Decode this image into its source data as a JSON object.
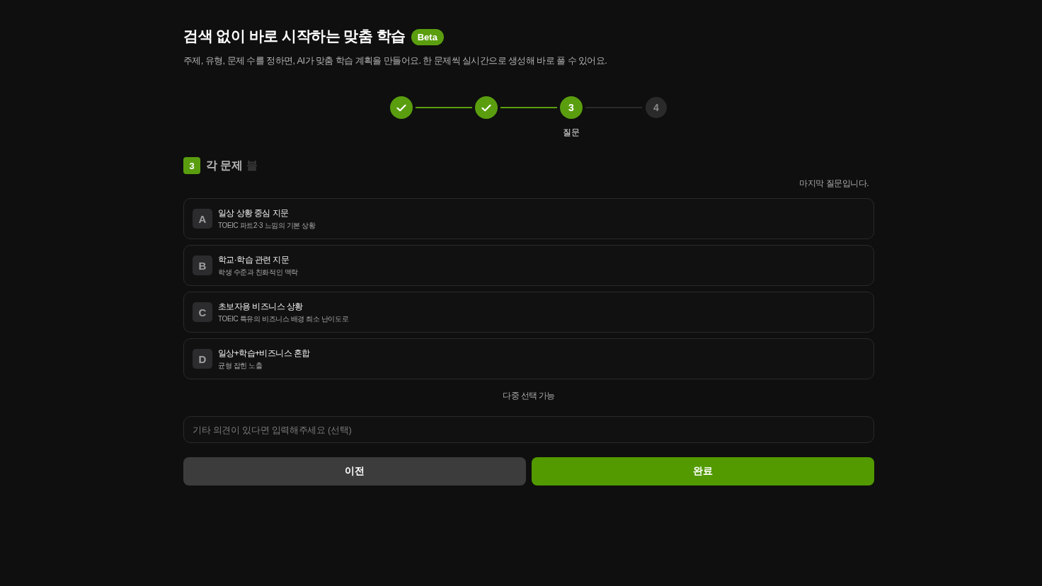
{
  "header": {
    "title": "검색 없이 바로 시작하는 맞춤 학습",
    "badge": "Beta",
    "subtitle": "주제, 유형, 문제 수를 정하면, AI가 맞춤 학습 계획을 만들어요. 한 문제씩 실시간으로 생성해 바로 풀 수 있어요."
  },
  "stepper": {
    "steps": [
      {
        "done": true,
        "current": false
      },
      {
        "done": true,
        "current": false
      },
      {
        "done": false,
        "current": true,
        "number": "3",
        "label": "질문"
      },
      {
        "done": false,
        "current": false,
        "number": "4"
      }
    ]
  },
  "question": {
    "number": "3",
    "title_parts": [
      {
        "text": "각 문제",
        "faded": false
      },
      {
        "text": "블",
        "faded": true
      }
    ],
    "note": "마지막 질문입니다.",
    "options": [
      {
        "letter": "A",
        "title": "일상 상황 중심 지문",
        "description": "TOEIC 파트2·3 느낌의 기본 상황",
        "selected": false
      },
      {
        "letter": "B",
        "title": "학교·학습 관련 지문",
        "description": "학생 수준과 친화적인 맥락",
        "selected": false
      },
      {
        "letter": "C",
        "title": "초보자용 비즈니스 상황",
        "description": "TOEIC 특유의 비즈니스 배경 최소 난이도로",
        "selected": false
      },
      {
        "letter": "D",
        "title": "일상+학습+비즈니스 혼합",
        "description": "균형 잡힌 노출",
        "selected": false
      }
    ],
    "hint": "다중 선택 가능"
  },
  "comment_field": {
    "placeholder": "기타 의견이 있다면 입력해주세요 (선택)"
  },
  "buttons": [
    {
      "label": "이전",
      "kind": "secondary"
    },
    {
      "label": "완료",
      "kind": "primary"
    }
  ]
}
